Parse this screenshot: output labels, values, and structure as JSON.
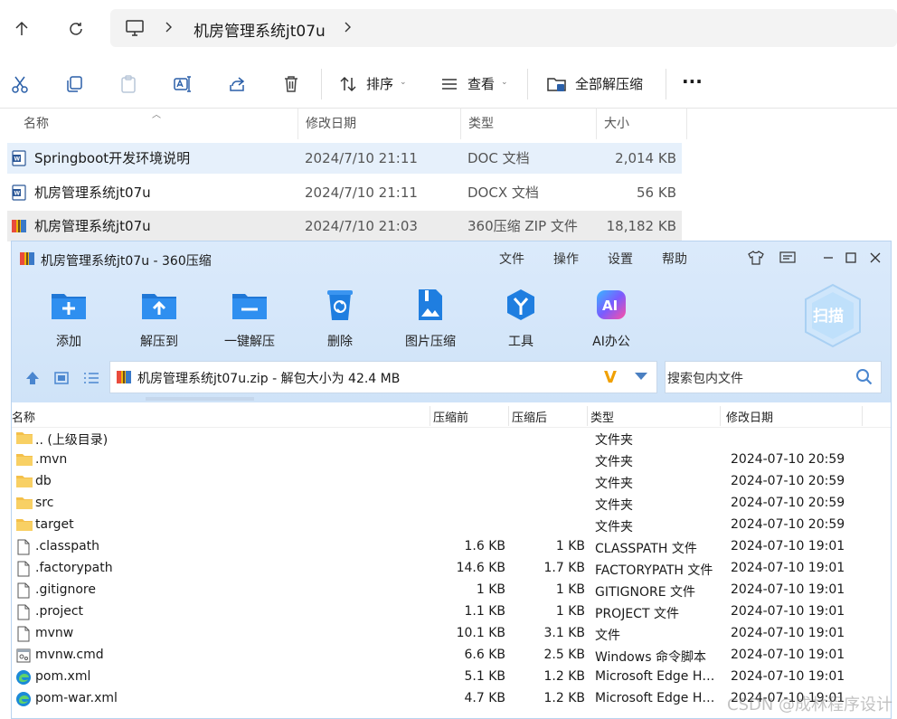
{
  "explorer": {
    "breadcrumb": "机房管理系统jt07u",
    "toolbar": {
      "sort_label": "排序",
      "view_label": "查看",
      "extract_all_label": "全部解压缩"
    },
    "columns": {
      "name": "名称",
      "date": "修改日期",
      "type": "类型",
      "size": "大小"
    },
    "files": [
      {
        "name": "Springboot开发环境说明",
        "date": "2024/7/10 21:11",
        "type": "DOC 文档",
        "size": "2,014 KB"
      },
      {
        "name": "机房管理系统jt07u",
        "date": "2024/7/10 21:11",
        "type": "DOCX 文档",
        "size": "56 KB"
      },
      {
        "name": "机房管理系统jt07u",
        "date": "2024/7/10 21:03",
        "type": "360压缩 ZIP 文件",
        "size": "18,182 KB"
      }
    ]
  },
  "archiver": {
    "title": "机房管理系统jt07u - 360压缩",
    "menu": {
      "file": "文件",
      "operate": "操作",
      "settings": "设置",
      "help": "帮助"
    },
    "tools": {
      "add": "添加",
      "extract_to": "解压到",
      "one_click": "一键解压",
      "delete": "删除",
      "image_compress": "图片压缩",
      "tools": "工具",
      "ai": "AI办公"
    },
    "ai_badge": "AI",
    "scan_label": "扫描",
    "path_text": "机房管理系统jt07u.zip - 解包大小为 42.4 MB",
    "search_placeholder": "搜索包内文件",
    "columns": {
      "name": "名称",
      "before": "压缩前",
      "after": "压缩后",
      "type": "类型",
      "date": "修改日期"
    },
    "rows": [
      {
        "name": ".. (上级目录)",
        "before": "",
        "after": "",
        "type": "文件夹",
        "date": ""
      },
      {
        "name": ".mvn",
        "before": "",
        "after": "",
        "type": "文件夹",
        "date": "2024-07-10 20:59"
      },
      {
        "name": "db",
        "before": "",
        "after": "",
        "type": "文件夹",
        "date": "2024-07-10 20:59"
      },
      {
        "name": "src",
        "before": "",
        "after": "",
        "type": "文件夹",
        "date": "2024-07-10 20:59"
      },
      {
        "name": "target",
        "before": "",
        "after": "",
        "type": "文件夹",
        "date": "2024-07-10 20:59"
      },
      {
        "name": ".classpath",
        "before": "1.6 KB",
        "after": "1 KB",
        "type": "CLASSPATH 文件",
        "date": "2024-07-10 19:01"
      },
      {
        "name": ".factorypath",
        "before": "14.6 KB",
        "after": "1.7 KB",
        "type": "FACTORYPATH 文件",
        "date": "2024-07-10 19:01"
      },
      {
        "name": ".gitignore",
        "before": "1 KB",
        "after": "1 KB",
        "type": "GITIGNORE 文件",
        "date": "2024-07-10 19:01"
      },
      {
        "name": ".project",
        "before": "1.1 KB",
        "after": "1 KB",
        "type": "PROJECT 文件",
        "date": "2024-07-10 19:01"
      },
      {
        "name": "mvnw",
        "before": "10.1 KB",
        "after": "3.1 KB",
        "type": "文件",
        "date": "2024-07-10 19:01"
      },
      {
        "name": "mvnw.cmd",
        "before": "6.6 KB",
        "after": "2.5 KB",
        "type": "Windows 命令脚本",
        "date": "2024-07-10 19:01"
      },
      {
        "name": "pom.xml",
        "before": "5.1 KB",
        "after": "1.2 KB",
        "type": "Microsoft Edge HT...",
        "date": "2024-07-10 19:01"
      },
      {
        "name": "pom-war.xml",
        "before": "4.7 KB",
        "after": "1.2 KB",
        "type": "Microsoft Edge HT...",
        "date": "2024-07-10 19:01"
      }
    ]
  },
  "watermark": "CSDN @成林程序设计"
}
